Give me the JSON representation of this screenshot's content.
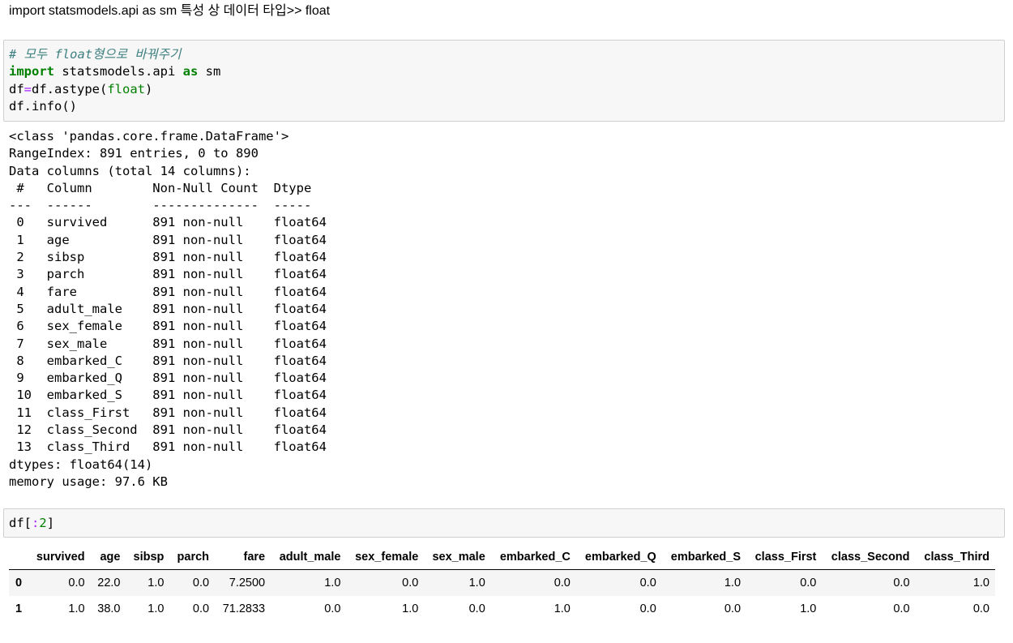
{
  "markdown": {
    "heading": "import statsmodels.api as sm 특성 상 데이터 타입>> float"
  },
  "cell1": {
    "comment": "# 모두 float형으로 바꿔주기",
    "line2_kw": "import",
    "line2_mod": " statsmodels.api ",
    "line2_as": "as",
    "line2_alias": " sm",
    "line3_lhs": "df",
    "line3_eq": "=",
    "line3_call": "df.astype(",
    "line3_arg": "float",
    "line3_close": ")",
    "line4": "df.info()"
  },
  "info_output": {
    "text": "<class 'pandas.core.frame.DataFrame'>\nRangeIndex: 891 entries, 0 to 890\nData columns (total 14 columns):\n #   Column        Non-Null Count  Dtype  \n---  ------        --------------  -----  \n 0   survived      891 non-null    float64\n 1   age           891 non-null    float64\n 2   sibsp         891 non-null    float64\n 3   parch         891 non-null    float64\n 4   fare          891 non-null    float64\n 5   adult_male    891 non-null    float64\n 6   sex_female    891 non-null    float64\n 7   sex_male      891 non-null    float64\n 8   embarked_C    891 non-null    float64\n 9   embarked_Q    891 non-null    float64\n 10  embarked_S    891 non-null    float64\n 11  class_First   891 non-null    float64\n 12  class_Second  891 non-null    float64\n 13  class_Third   891 non-null    float64\ndtypes: float64(14)\nmemory usage: 97.6 KB"
  },
  "cell2": {
    "code_prefix": "df[",
    "code_colon": ":",
    "code_num": "2",
    "code_suffix": "]"
  },
  "table": {
    "columns": [
      "",
      "survived",
      "age",
      "sibsp",
      "parch",
      "fare",
      "adult_male",
      "sex_female",
      "sex_male",
      "embarked_C",
      "embarked_Q",
      "embarked_S",
      "class_First",
      "class_Second",
      "class_Third"
    ],
    "rows": [
      [
        "0",
        "0.0",
        "22.0",
        "1.0",
        "0.0",
        "7.2500",
        "1.0",
        "0.0",
        "1.0",
        "0.0",
        "0.0",
        "1.0",
        "0.0",
        "0.0",
        "1.0"
      ],
      [
        "1",
        "1.0",
        "38.0",
        "1.0",
        "0.0",
        "71.2833",
        "0.0",
        "1.0",
        "0.0",
        "1.0",
        "0.0",
        "0.0",
        "1.0",
        "0.0",
        "0.0"
      ]
    ]
  },
  "colors": {
    "cell_bg": "#f7f7f7",
    "cell_border": "#cfcfcf",
    "comment": "#408080",
    "keyword": "#008000",
    "operator": "#aa22ff",
    "row_stripe": "#f5f5f5"
  }
}
